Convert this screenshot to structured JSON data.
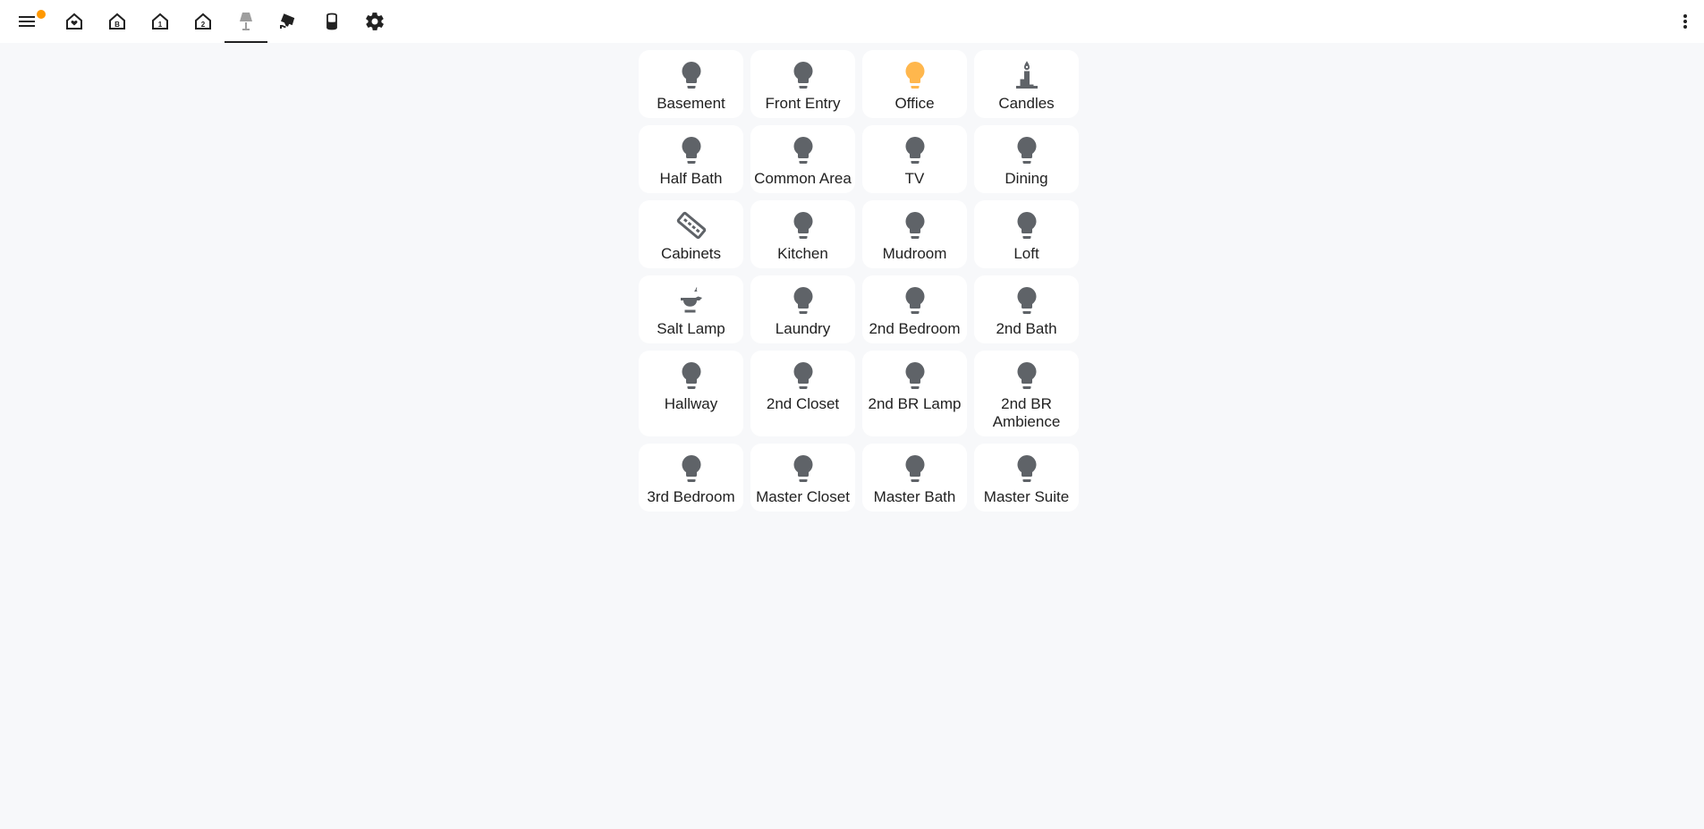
{
  "toolbar": {
    "tabs": [
      {
        "name": "menu-icon"
      },
      {
        "name": "home-heart-icon"
      },
      {
        "name": "home-basement-icon"
      },
      {
        "name": "home-floor-1-icon"
      },
      {
        "name": "home-floor-2-icon"
      },
      {
        "name": "lamp-icon"
      },
      {
        "name": "cctv-icon"
      },
      {
        "name": "speaker-icon"
      },
      {
        "name": "gear-icon"
      }
    ],
    "overflow_icon": "dots-vertical-icon"
  },
  "colors": {
    "icon_off": "#5f6368",
    "icon_on": "#ffb74d",
    "badge": "#ff9800",
    "background": "#f7f8fa",
    "card": "#ffffff"
  },
  "lights": [
    {
      "label": "Basement",
      "icon": "lightbulb-icon",
      "state": "off"
    },
    {
      "label": "Front Entry",
      "icon": "lightbulb-icon",
      "state": "off"
    },
    {
      "label": "Office",
      "icon": "lightbulb-icon",
      "state": "on"
    },
    {
      "label": "Candles",
      "icon": "candle-icon",
      "state": "off"
    },
    {
      "label": "Half Bath",
      "icon": "lightbulb-icon",
      "state": "off"
    },
    {
      "label": "Common Area",
      "icon": "lightbulb-icon",
      "state": "off"
    },
    {
      "label": "TV",
      "icon": "lightbulb-icon",
      "state": "off"
    },
    {
      "label": "Dining",
      "icon": "lightbulb-icon",
      "state": "off"
    },
    {
      "label": "Cabinets",
      "icon": "led-strip-icon",
      "state": "off"
    },
    {
      "label": "Kitchen",
      "icon": "lightbulb-icon",
      "state": "off"
    },
    {
      "label": "Mudroom",
      "icon": "lightbulb-icon",
      "state": "off"
    },
    {
      "label": "Loft",
      "icon": "lightbulb-icon",
      "state": "off"
    },
    {
      "label": "Salt Lamp",
      "icon": "oil-lamp-icon",
      "state": "off"
    },
    {
      "label": "Laundry",
      "icon": "lightbulb-icon",
      "state": "off"
    },
    {
      "label": "2nd Bedroom",
      "icon": "lightbulb-icon",
      "state": "off"
    },
    {
      "label": "2nd Bath",
      "icon": "lightbulb-icon",
      "state": "off"
    },
    {
      "label": "Hallway",
      "icon": "lightbulb-icon",
      "state": "off"
    },
    {
      "label": "2nd Closet",
      "icon": "lightbulb-icon",
      "state": "off"
    },
    {
      "label": "2nd BR Lamp",
      "icon": "lightbulb-icon",
      "state": "off"
    },
    {
      "label": "2nd BR Ambience",
      "icon": "lightbulb-icon",
      "state": "off"
    },
    {
      "label": "3rd Bedroom",
      "icon": "lightbulb-icon",
      "state": "off"
    },
    {
      "label": "Master Closet",
      "icon": "lightbulb-icon",
      "state": "off"
    },
    {
      "label": "Master Bath",
      "icon": "lightbulb-icon",
      "state": "off"
    },
    {
      "label": "Master Suite",
      "icon": "lightbulb-icon",
      "state": "off"
    }
  ]
}
